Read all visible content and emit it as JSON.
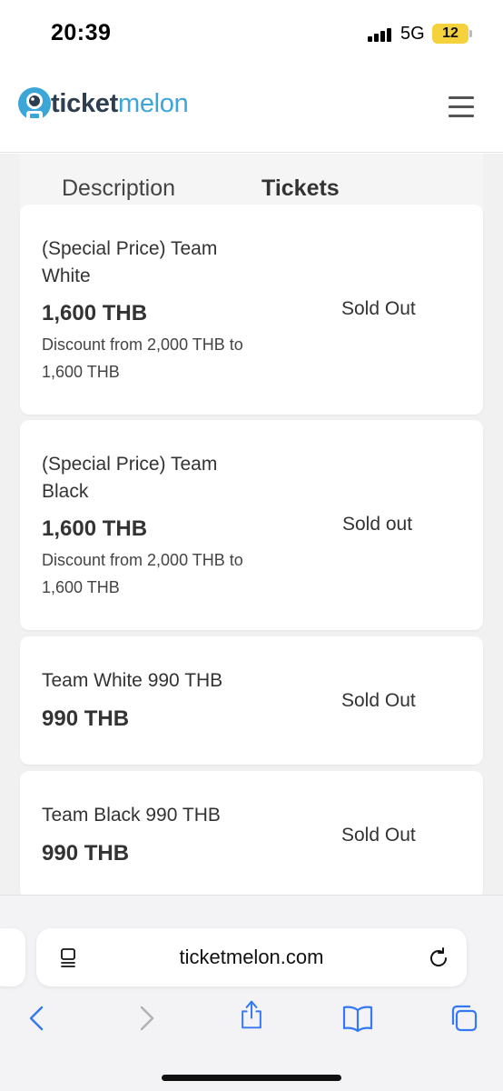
{
  "status_bar": {
    "time": "20:39",
    "network": "5G",
    "battery": "12"
  },
  "site": {
    "logo_dark": "ticket",
    "logo_light": "melon"
  },
  "tabs": [
    {
      "label": "Description",
      "active": false
    },
    {
      "label": "Tickets",
      "active": true
    }
  ],
  "tickets": [
    {
      "name": "(Special Price) Team White",
      "price": "1,600 THB",
      "discount": "Discount from 2,000 THB to 1,600 THB",
      "status": "Sold Out"
    },
    {
      "name": "(Special Price) Team Black",
      "price": "1,600 THB",
      "discount": "Discount from 2,000 THB to 1,600 THB",
      "status": "Sold out"
    },
    {
      "name": "Team White 990 THB",
      "price": "990 THB",
      "status": "Sold Out"
    },
    {
      "name": "Team Black 990 THB",
      "price": "990 THB",
      "status": "Sold Out"
    }
  ],
  "browser": {
    "url": "ticketmelon.com",
    "toolbar_icons": [
      "back-icon",
      "forward-icon",
      "share-icon",
      "bookmarks-icon",
      "tabs-icon"
    ]
  },
  "colors": {
    "brand_blue": "#3ca6d8",
    "brand_dark": "#2d3e50",
    "ios_blue": "#3478f6",
    "battery_yellow": "#f5d13b"
  }
}
